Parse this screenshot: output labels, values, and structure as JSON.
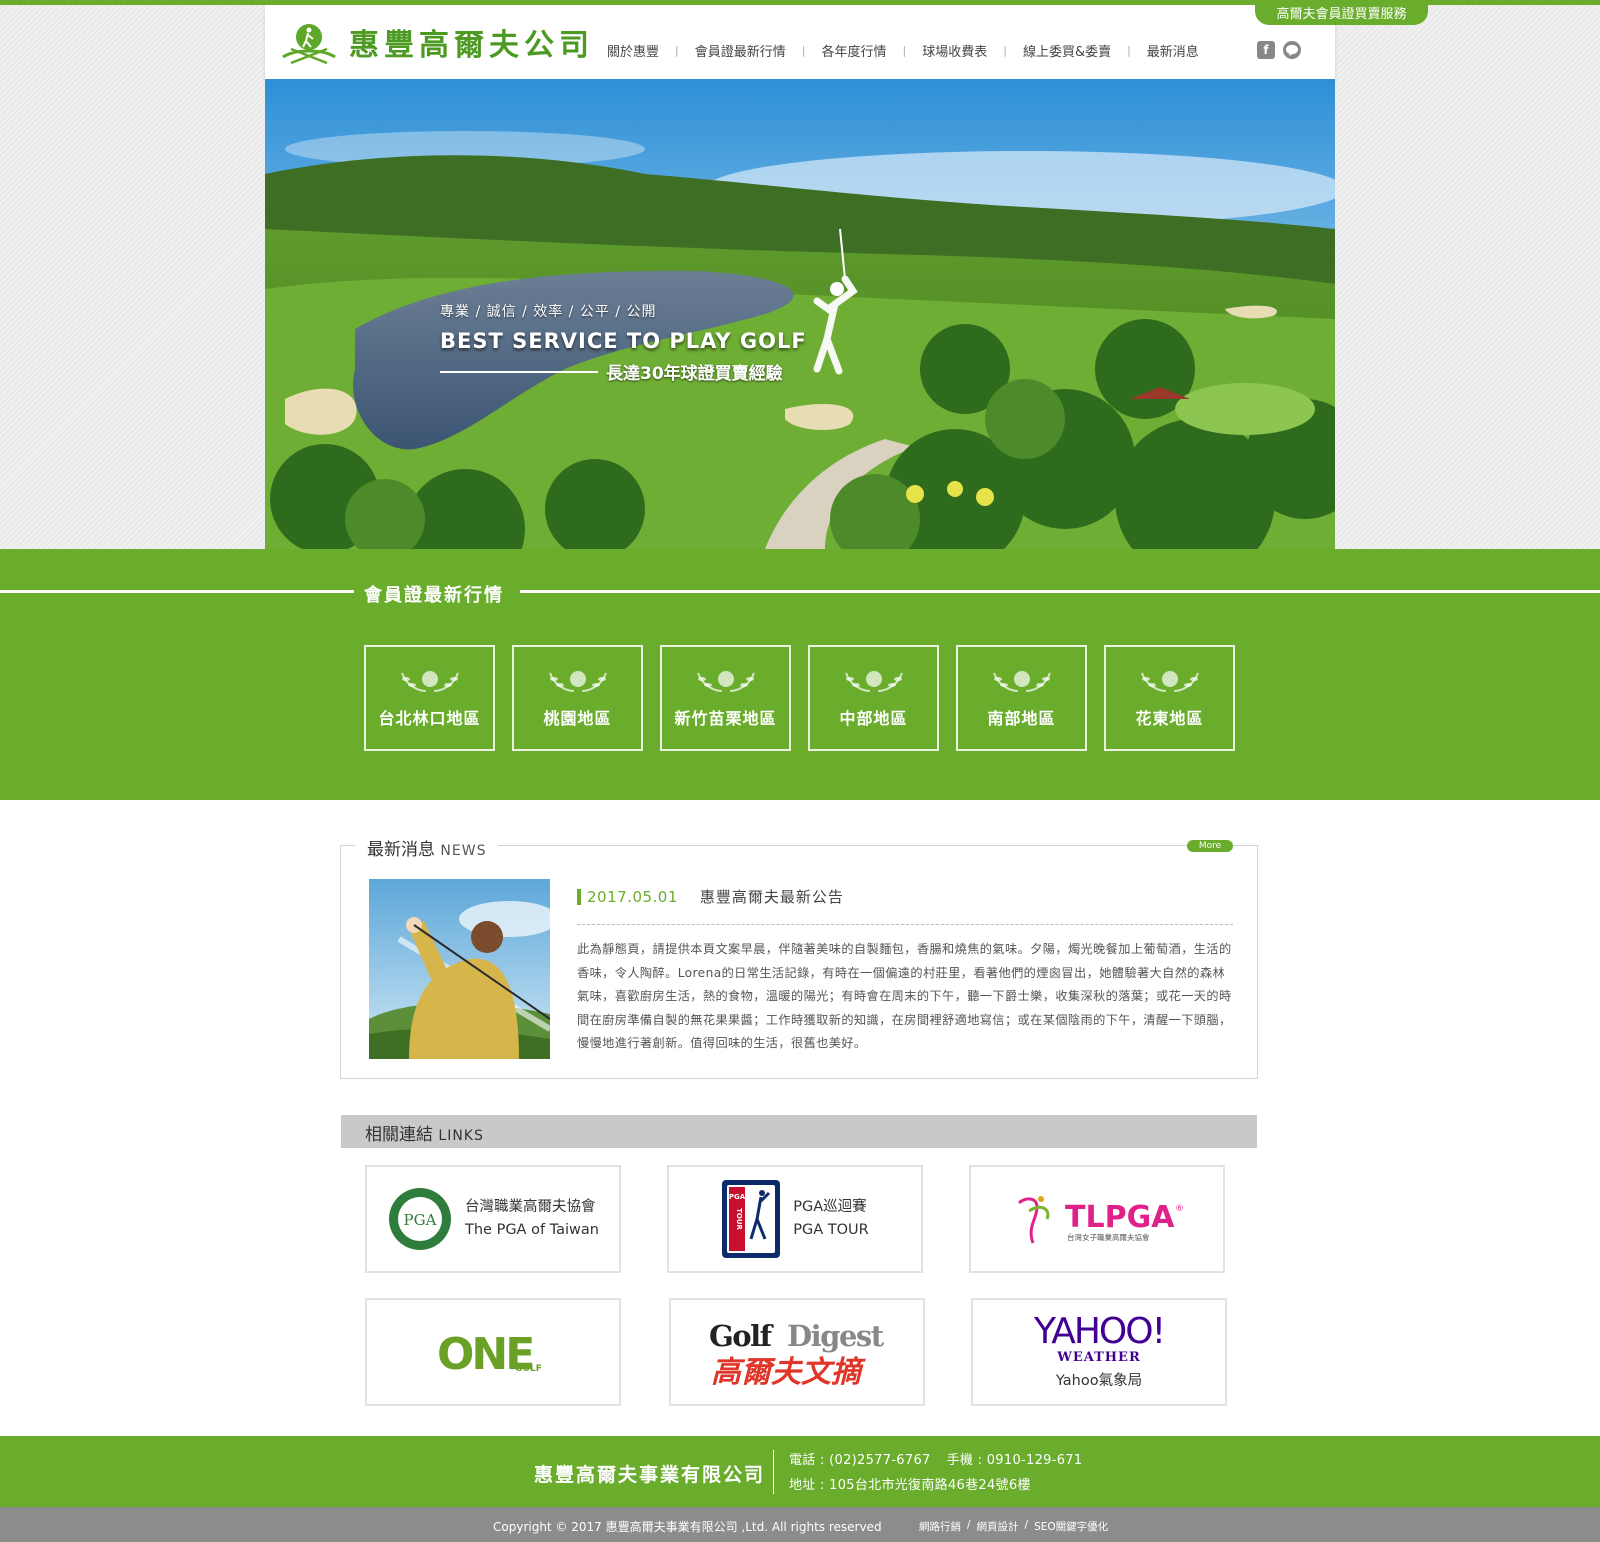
{
  "header": {
    "service_tab": "高爾夫會員證買賣服務",
    "logo_text": "惠豐高爾夫公司",
    "nav": [
      "關於惠豐",
      "會員證最新行情",
      "各年度行情",
      "球場收費表",
      "線上委買&委賣",
      "最新消息"
    ],
    "social": [
      {
        "icon": "facebook-icon",
        "glyph": "f"
      },
      {
        "icon": "line-icon",
        "glyph": "LINE"
      }
    ]
  },
  "hero": {
    "subtitle": "專業 / 誠信 / 效率 / 公平 / 公開",
    "title": "BEST SERVICE TO PLAY GOLF",
    "tagline": "長達30年球證買賣經驗"
  },
  "market": {
    "title": "會員證最新行情",
    "regions": [
      "台北林口地區",
      "桃園地區",
      "新竹苗栗地區",
      "中部地區",
      "南部地區",
      "花東地區"
    ]
  },
  "news": {
    "title": "最新消息",
    "title_en": "NEWS",
    "more": "More",
    "date": "2017.05.01",
    "headline": "惠豐高爾夫最新公告",
    "body": "此為靜態頁，請提供本頁文案早晨，伴隨著美味的自製麵包，香腸和燒焦的氣味。夕陽，燭光晚餐加上葡萄酒，生活的香味，令人陶醉。Lorena的日常生活記錄，有時在一個偏遠的村莊里，看著他們的煙囪冒出，她體驗著大自然的森林氣味，喜歡廚房生活，熱的食物，溫暖的陽光；有時會在周末的下午，聽一下爵士樂，收集深秋的落葉；或花一天的時間在廚房準備自製的無花果果醬；工作時獲取新的知識，在房間裡舒適地寫信；或在某個陰雨的下午，清醒一下頭腦，慢慢地進行著創新。值得回味的生活，很舊也美好。"
  },
  "links": {
    "title": "相關連結",
    "title_en": "LINKS",
    "pga_taiwan": {
      "line1": "台灣職業高爾夫協會",
      "line2": "The PGA of Taiwan",
      "badge": "PGA"
    },
    "pga_tour": {
      "line1": "PGA巡迴賽",
      "line2": "PGA TOUR",
      "badge_top": "PGA",
      "badge_side": "TOUR"
    },
    "tlpga": {
      "logo": "TLPGA",
      "reg": "®",
      "sub": "台灣女子職業高爾夫協會"
    },
    "one_golf": {
      "logo": "ONE",
      "sub": "GOLF"
    },
    "golf_digest": {
      "line1_a": "Golf",
      "line1_b": "Digest",
      "line2": "高爾夫文摘"
    },
    "yahoo": {
      "logo": "YAHOO!",
      "sub": "WEATHER",
      "caption": "Yahoo氣象局"
    }
  },
  "footer": {
    "company": "惠豐高爾夫事業有限公司",
    "phone": "電話 : (02)2577-6767",
    "mobile": "手機 : 0910-129-671",
    "address": "地址 : 105台北市光復南路46巷24號6樓",
    "copyright": "Copyright © 2017 惠豐高爾夫事業有限公司 ,Ltd. All rights reserved",
    "credits": [
      "網路行銷",
      "網頁設計",
      "SEO關鍵字優化"
    ],
    "credit_sep": "/"
  },
  "colors": {
    "brand_green": "#6aad2c",
    "logo_green": "#4d9a22",
    "footer_gray": "#8c8c8c",
    "tlpga_pink": "#e0218a",
    "yahoo_purple": "#410093"
  }
}
